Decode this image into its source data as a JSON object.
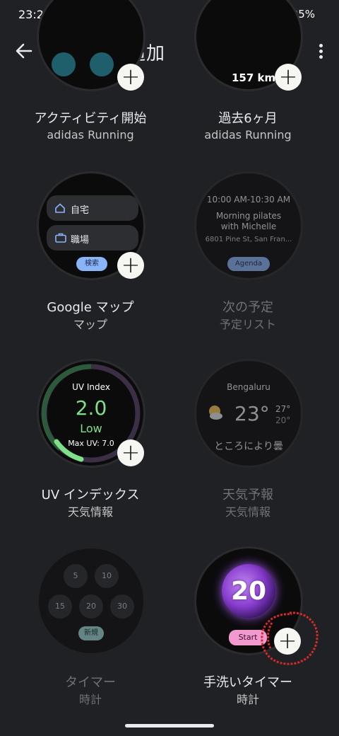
{
  "status": {
    "time": "23:20",
    "battery": "95%"
  },
  "appbar": {
    "title": "タイルを追加"
  },
  "tiles": [
    {
      "name": "アクティビティ開始",
      "sub": "adidas Running"
    },
    {
      "name": "過去6ヶ月",
      "sub": "adidas Running",
      "preview": "157 km"
    },
    {
      "name": "Google マップ",
      "sub": "マップ",
      "preview": {
        "home": "自宅",
        "work": "職場",
        "search": "検索"
      }
    },
    {
      "name": "次の予定",
      "sub": "予定リスト",
      "preview": {
        "time": "10:00 AM-10:30 AM",
        "event1": "Morning pilates",
        "event2": "with Michelle",
        "address": "6801 Pine St, San Fran...",
        "button": "Agenda"
      }
    },
    {
      "name": "UV インデックス",
      "sub": "天気情報",
      "preview": {
        "label": "UV Index",
        "value": "2.0",
        "level": "Low",
        "max": "Max UV: 7.0"
      }
    },
    {
      "name": "天気予報",
      "sub": "天気情報",
      "preview": {
        "city": "Bengaluru",
        "temp": "23°",
        "high": "27°",
        "low": "20°",
        "cond": "ところにより曇"
      }
    },
    {
      "name": "タイマー",
      "sub": "時計",
      "preview": {
        "t1": "5",
        "t2": "10",
        "t3": "15",
        "t4": "20",
        "t5": "30",
        "new": "新規"
      }
    },
    {
      "name": "手洗いタイマー",
      "sub": "時計",
      "preview": {
        "count": "20",
        "start": "Start"
      }
    }
  ],
  "colors": {
    "background": "#202124",
    "annotation": "#d42a2a",
    "uv_green": "#7fe08a"
  }
}
